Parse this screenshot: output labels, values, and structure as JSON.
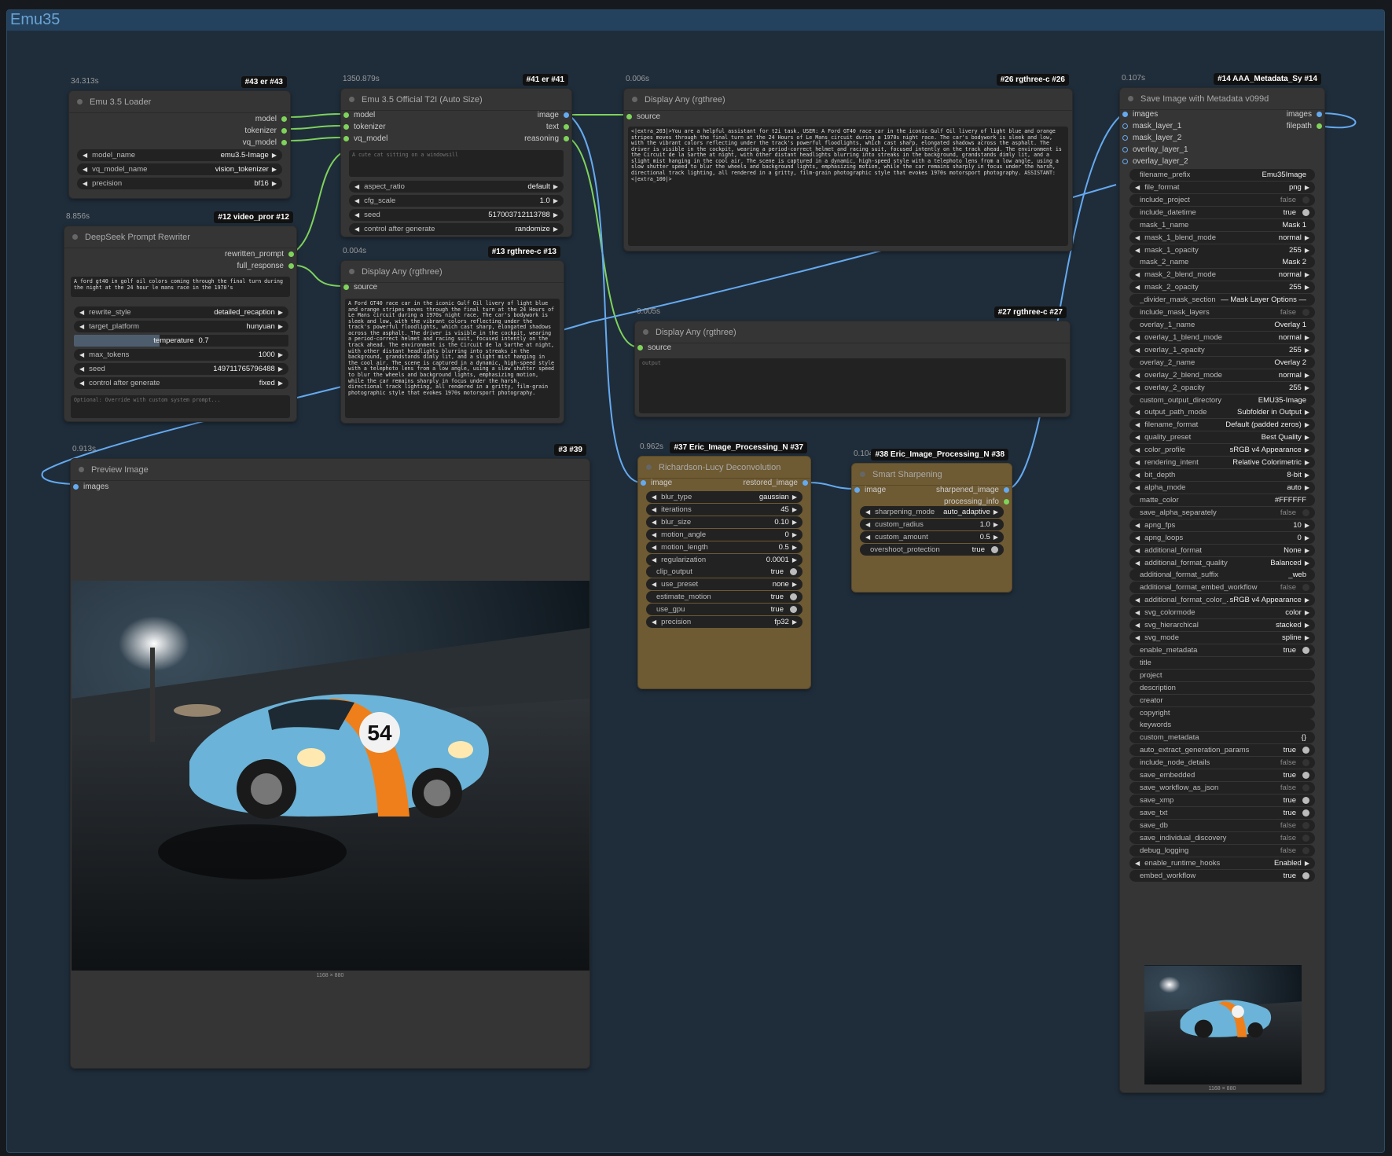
{
  "group": {
    "title": "Emu35"
  },
  "colors": {
    "accent": "#65aaf0",
    "link_green": "#7fd35b",
    "node_bg": "#353535",
    "node_gold": "#6e5a33"
  },
  "loader": {
    "timing": "34.313s",
    "badge": "#43 er #43",
    "title": "Emu 3.5 Loader",
    "outputs": [
      "model",
      "tokenizer",
      "vq_model"
    ],
    "widgets": [
      {
        "label": "model_name",
        "value": "emu3.5-Image"
      },
      {
        "label": "vq_model_name",
        "value": "vision_tokenizer"
      },
      {
        "label": "precision",
        "value": "bf16"
      }
    ]
  },
  "t2i": {
    "timing": "1350.879s",
    "badge": "#41 er #41",
    "title": "Emu 3.5 Official T2I (Auto Size)",
    "inputs": [
      "model",
      "tokenizer",
      "vq_model"
    ],
    "outputs": [
      "image",
      "text",
      "reasoning"
    ],
    "prompt": "A cute cat sitting on a windowsill",
    "widgets": [
      {
        "label": "aspect_ratio",
        "value": "default"
      },
      {
        "label": "cfg_scale",
        "value": "1.0"
      },
      {
        "label": "seed",
        "value": "517003712113788"
      },
      {
        "label": "control after generate",
        "value": "randomize"
      }
    ]
  },
  "display26": {
    "timing": "0.006s",
    "badge": "#26 rgthree-c #26",
    "title": "Display Any (rgthree)",
    "input": "source",
    "text": "<|extra_203|>You are a helpful assistant for t2i task. USER: A Ford GT40 race car in the iconic Gulf Oil livery of light blue and orange stripes moves through the final turn at the 24 Hours of Le Mans circuit during a 1970s night race. The car's bodywork is sleek and low, with the vibrant colors reflecting under the track's powerful floodlights, which cast sharp, elongated shadows across the asphalt. The driver is visible in the cockpit, wearing a period-correct helmet and racing suit, focused intently on the track ahead. The environment is the Circuit de la Sarthe at night, with other distant headlights blurring into streaks in the background, grandstands dimly lit, and a slight mist hanging in the cool air. The scene is captured in a dynamic, high-speed style with a telephoto lens from a low angle, using a slow shutter speed to blur the wheels and background lights, emphasizing motion, while the car remains sharply in focus under the harsh, directional track lighting, all rendered in a gritty, film-grain photographic style that evokes 1970s motorsport photography. ASSISTANT: <|extra_100|>"
  },
  "rewriter": {
    "timing": "8.856s",
    "badge": "#12 video_pror #12",
    "title": "DeepSeek Prompt Rewriter",
    "outputs": [
      "rewritten_prompt",
      "full_response"
    ],
    "prompt": "A ford gt40 in golf oil colors coming through the final turn during the night at the 24 hour le mans race in the 1970's",
    "widgets": [
      {
        "label": "rewrite_style",
        "value": "detailed_recaption"
      },
      {
        "label": "target_platform",
        "value": "hunyuan"
      },
      {
        "label": "temperature",
        "value": "0.7",
        "fill": 0.4
      },
      {
        "label": "max_tokens",
        "value": "1000"
      },
      {
        "label": "seed",
        "value": "149711765796488"
      },
      {
        "label": "control after generate",
        "value": "fixed"
      }
    ],
    "system_placeholder": "Optional: Override with custom system prompt..."
  },
  "display13": {
    "timing": "0.004s",
    "badge": "#13 rgthree-c #13",
    "title": "Display Any (rgthree)",
    "input": "source",
    "text": "A Ford GT40 race car in the iconic Gulf Oil livery of light blue and orange stripes moves through the final turn at the 24 Hours of Le Mans circuit during a 1970s night race. The car's bodywork is sleek and low, with the vibrant colors reflecting under the track's powerful floodlights, which cast sharp, elongated shadows across the asphalt. The driver is visible in the cockpit, wearing a period-correct helmet and racing suit, focused intently on the track ahead. The environment is the Circuit de la Sarthe at night, with other distant headlights blurring into streaks in the background, grandstands dimly lit, and a slight mist hanging in the cool air. The scene is captured in a dynamic, high-speed style with a telephoto lens from a low angle, using a slow shutter speed to blur the wheels and background lights, emphasizing motion, while the car remains sharply in focus under the harsh, directional track lighting, all rendered in a gritty, film-grain photographic style that evokes 1970s motorsport photography."
  },
  "display27": {
    "timing": "0.005s",
    "badge": "#27 rgthree-c #27",
    "title": "Display Any (rgthree)",
    "input": "source",
    "placeholder": "output"
  },
  "preview": {
    "timing": "0.913s",
    "badge": "#3 #39",
    "title": "Preview Image",
    "input": "images",
    "size_caption": "1168 × 880",
    "car_number": "54"
  },
  "rl": {
    "timing": "0.962s",
    "badge": "#37 Eric_Image_Processing_N #37",
    "title": "Richardson-Lucy Deconvolution",
    "input": "image",
    "output": "restored_image",
    "widgets": [
      {
        "label": "blur_type",
        "value": "gaussian",
        "kind": "combo"
      },
      {
        "label": "iterations",
        "value": "45",
        "kind": "combo"
      },
      {
        "label": "blur_size",
        "value": "0.10",
        "kind": "combo"
      },
      {
        "label": "motion_angle",
        "value": "0",
        "kind": "combo"
      },
      {
        "label": "motion_length",
        "value": "0.5",
        "kind": "combo"
      },
      {
        "label": "regularization",
        "value": "0.0001",
        "kind": "combo"
      },
      {
        "label": "clip_output",
        "value": "true",
        "kind": "toggle"
      },
      {
        "label": "use_preset",
        "value": "none",
        "kind": "combo"
      },
      {
        "label": "estimate_motion",
        "value": "true",
        "kind": "toggle"
      },
      {
        "label": "use_gpu",
        "value": "true",
        "kind": "toggle"
      },
      {
        "label": "precision",
        "value": "fp32",
        "kind": "combo"
      }
    ]
  },
  "sharp": {
    "timing": "0.104s",
    "badge": "#38 Eric_Image_Processing_N #38",
    "title": "Smart Sharpening",
    "input": "image",
    "outputs": [
      "sharpened_image",
      "processing_info"
    ],
    "widgets": [
      {
        "label": "sharpening_mode",
        "value": "auto_adaptive",
        "kind": "combo"
      },
      {
        "label": "custom_radius",
        "value": "1.0",
        "kind": "combo"
      },
      {
        "label": "custom_amount",
        "value": "0.5",
        "kind": "combo"
      },
      {
        "label": "overshoot_protection",
        "value": "true",
        "kind": "toggle"
      }
    ]
  },
  "save": {
    "timing": "0.107s",
    "badge": "#14 AAA_Metadata_Sy #14",
    "title": "Save Image with Metadata v099d",
    "inputs": [
      "images",
      "mask_layer_1",
      "mask_layer_2",
      "overlay_layer_1",
      "overlay_layer_2"
    ],
    "outputs": [
      "images",
      "filepath"
    ],
    "size_caption": "1168 × 880",
    "widgets": [
      {
        "label": "filename_prefix",
        "value": "Emu35Image",
        "kind": "text"
      },
      {
        "label": "file_format",
        "value": "png",
        "kind": "combo"
      },
      {
        "label": "include_project",
        "value": "false",
        "kind": "off"
      },
      {
        "label": "include_datetime",
        "value": "true",
        "kind": "toggle"
      },
      {
        "label": "mask_1_name",
        "value": "Mask 1",
        "kind": "text"
      },
      {
        "label": "mask_1_blend_mode",
        "value": "normal",
        "kind": "combo"
      },
      {
        "label": "mask_1_opacity",
        "value": "255",
        "kind": "combo"
      },
      {
        "label": "mask_2_name",
        "value": "Mask 2",
        "kind": "text"
      },
      {
        "label": "mask_2_blend_mode",
        "value": "normal",
        "kind": "combo"
      },
      {
        "label": "mask_2_opacity",
        "value": "255",
        "kind": "combo"
      },
      {
        "label": "_divider_mask_section",
        "value": "— Mask Layer Options —",
        "kind": "text"
      },
      {
        "label": "include_mask_layers",
        "value": "false",
        "kind": "off"
      },
      {
        "label": "overlay_1_name",
        "value": "Overlay 1",
        "kind": "text"
      },
      {
        "label": "overlay_1_blend_mode",
        "value": "normal",
        "kind": "combo"
      },
      {
        "label": "overlay_1_opacity",
        "value": "255",
        "kind": "combo"
      },
      {
        "label": "overlay_2_name",
        "value": "Overlay 2",
        "kind": "text"
      },
      {
        "label": "overlay_2_blend_mode",
        "value": "normal",
        "kind": "combo"
      },
      {
        "label": "overlay_2_opacity",
        "value": "255",
        "kind": "combo"
      },
      {
        "label": "custom_output_directory",
        "value": "EMU35-Image",
        "kind": "text"
      },
      {
        "label": "output_path_mode",
        "value": "Subfolder in Output",
        "kind": "combo"
      },
      {
        "label": "filename_format",
        "value": "Default (padded zeros)",
        "kind": "combo"
      },
      {
        "label": "quality_preset",
        "value": "Best Quality",
        "kind": "combo"
      },
      {
        "label": "color_profile",
        "value": "sRGB v4 Appearance",
        "kind": "combo"
      },
      {
        "label": "rendering_intent",
        "value": "Relative Colorimetric",
        "kind": "combo"
      },
      {
        "label": "bit_depth",
        "value": "8-bit",
        "kind": "combo"
      },
      {
        "label": "alpha_mode",
        "value": "auto",
        "kind": "combo"
      },
      {
        "label": "matte_color",
        "value": "#FFFFFF",
        "kind": "text"
      },
      {
        "label": "save_alpha_separately",
        "value": "false",
        "kind": "off"
      },
      {
        "label": "apng_fps",
        "value": "10",
        "kind": "combo"
      },
      {
        "label": "apng_loops",
        "value": "0",
        "kind": "combo"
      },
      {
        "label": "additional_format",
        "value": "None",
        "kind": "combo"
      },
      {
        "label": "additional_format_quality",
        "value": "Balanced",
        "kind": "combo"
      },
      {
        "label": "additional_format_suffix",
        "value": "_web",
        "kind": "text"
      },
      {
        "label": "additional_format_embed_workflow",
        "value": "false",
        "kind": "off"
      },
      {
        "label": "additional_format_color_...",
        "value": "sRGB v4 Appearance",
        "kind": "combo"
      },
      {
        "label": "svg_colormode",
        "value": "color",
        "kind": "combo"
      },
      {
        "label": "svg_hierarchical",
        "value": "stacked",
        "kind": "combo"
      },
      {
        "label": "svg_mode",
        "value": "spline",
        "kind": "combo"
      },
      {
        "label": "enable_metadata",
        "value": "true",
        "kind": "toggle"
      },
      {
        "label": "title",
        "value": "",
        "kind": "text"
      },
      {
        "label": "project",
        "value": "",
        "kind": "text"
      },
      {
        "label": "description",
        "value": "",
        "kind": "text"
      },
      {
        "label": "creator",
        "value": "",
        "kind": "text"
      },
      {
        "label": "copyright",
        "value": "",
        "kind": "text"
      },
      {
        "label": "keywords",
        "value": "",
        "kind": "text"
      },
      {
        "label": "custom_metadata",
        "value": "{}",
        "kind": "text"
      },
      {
        "label": "auto_extract_generation_params",
        "value": "true",
        "kind": "toggle"
      },
      {
        "label": "include_node_details",
        "value": "false",
        "kind": "off"
      },
      {
        "label": "save_embedded",
        "value": "true",
        "kind": "toggle"
      },
      {
        "label": "save_workflow_as_json",
        "value": "false",
        "kind": "off"
      },
      {
        "label": "save_xmp",
        "value": "true",
        "kind": "toggle"
      },
      {
        "label": "save_txt",
        "value": "true",
        "kind": "toggle"
      },
      {
        "label": "save_db",
        "value": "false",
        "kind": "off"
      },
      {
        "label": "save_individual_discovery",
        "value": "false",
        "kind": "off"
      },
      {
        "label": "debug_logging",
        "value": "false",
        "kind": "off"
      },
      {
        "label": "enable_runtime_hooks",
        "value": "Enabled",
        "kind": "combo"
      },
      {
        "label": "embed_workflow",
        "value": "true",
        "kind": "toggle"
      }
    ]
  }
}
